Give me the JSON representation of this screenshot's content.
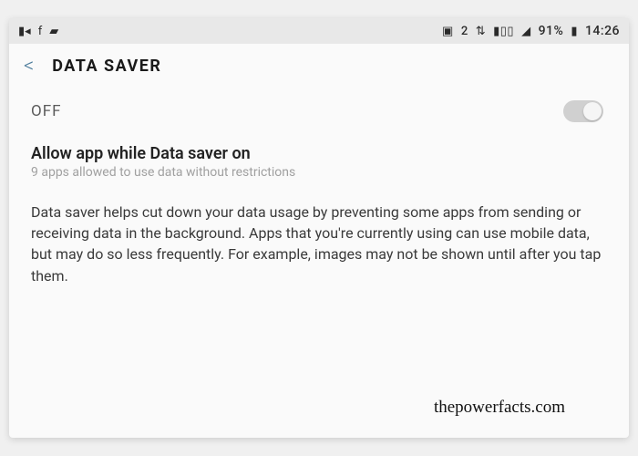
{
  "status_bar": {
    "battery_pct": "91%",
    "time": "14:26"
  },
  "header": {
    "back_glyph": "<",
    "title": "DATA SAVER"
  },
  "toggle": {
    "label": "OFF",
    "state": "off"
  },
  "allow_row": {
    "title": "Allow app while Data saver on",
    "subtitle": "9 apps allowed to use data without restrictions"
  },
  "description": "Data saver helps cut down your data usage by preventing some apps from sending or receiving data in the background. Apps that you're currently using can use mobile data, but may do so less frequently. For example, images may not be shown until after you tap them.",
  "watermark": "thepowerfacts.com"
}
